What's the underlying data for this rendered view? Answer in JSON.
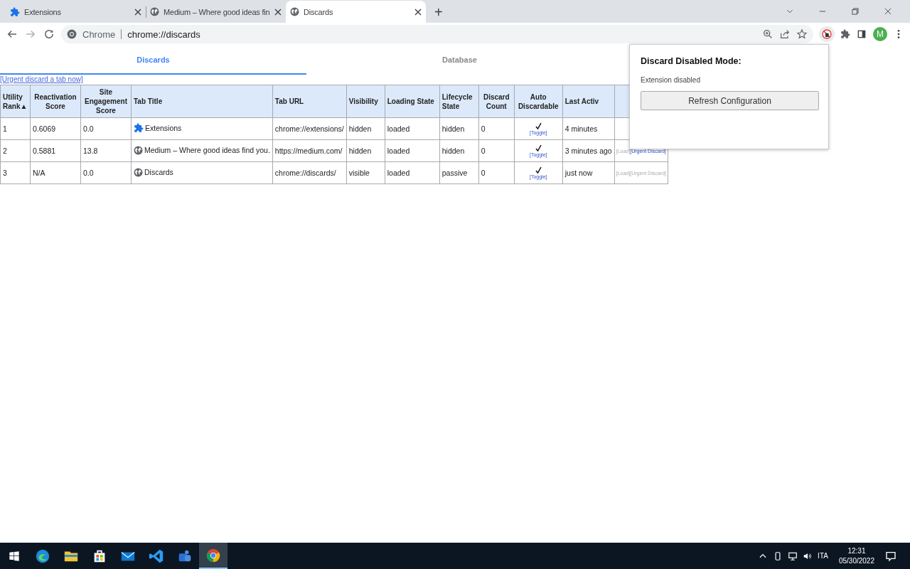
{
  "browser": {
    "tabs": [
      {
        "title": "Extensions",
        "kind": "puzzle",
        "selected": false
      },
      {
        "title": "Medium – Where good ideas fin",
        "kind": "globe",
        "selected": false
      },
      {
        "title": "Discards",
        "kind": "globe",
        "selected": true
      }
    ],
    "new_tab": "+",
    "omnibox": {
      "origin": "Chrome",
      "url": "chrome://discards"
    },
    "profile": "M"
  },
  "page": {
    "tabs": [
      {
        "label": "Discards",
        "selected": true
      },
      {
        "label": "Database",
        "selected": false
      }
    ],
    "urgent_link": "[Urgent discard a tab now]",
    "table": {
      "columns": [
        {
          "label": "Utility Rank",
          "sort": "▲"
        },
        {
          "label": "Reactivation Score"
        },
        {
          "label": "Site Engagement Score"
        },
        {
          "label": "Tab Title"
        },
        {
          "label": "Tab URL"
        },
        {
          "label": "Visibility"
        },
        {
          "label": "Loading State"
        },
        {
          "label": "Lifecycle State"
        },
        {
          "label": "Discard Count"
        },
        {
          "label": "Auto Discardable"
        },
        {
          "label": "Last Activ"
        }
      ],
      "rows": [
        {
          "rank": "1",
          "reactivation": "0.6069",
          "engagement": "0.0",
          "title": "Extensions",
          "kind": "puzzle",
          "url": "chrome://extensions/",
          "visibility": "hidden",
          "loading": "loaded",
          "lifecycle": "hidden",
          "discard_count": "0",
          "auto_discardable": true,
          "toggle": "[Toggle]",
          "last_active": "4 minutes"
        },
        {
          "rank": "2",
          "reactivation": "0.5881",
          "engagement": "13.8",
          "title": "Medium – Where good ideas find you.",
          "kind": "globe",
          "url": "https://medium.com/",
          "visibility": "hidden",
          "loading": "loaded",
          "lifecycle": "hidden",
          "discard_count": "0",
          "auto_discardable": true,
          "toggle": "[Toggle]",
          "last_active": "3 minutes ago",
          "actions": [
            {
              "label": "[Load]",
              "disabled": true
            },
            {
              "label": "[Urgent Discard]",
              "disabled": false
            }
          ]
        },
        {
          "rank": "3",
          "reactivation": "N/A",
          "engagement": "0.0",
          "title": "Discards",
          "kind": "globe",
          "url": "chrome://discards/",
          "visibility": "visible",
          "loading": "loaded",
          "lifecycle": "passive",
          "discard_count": "0",
          "auto_discardable": true,
          "toggle": "[Toggle]",
          "last_active": "just now",
          "actions": [
            {
              "label": "[Load]",
              "disabled": true
            },
            {
              "label": "[Urgent Discard]",
              "disabled": true
            }
          ]
        }
      ]
    }
  },
  "popup": {
    "title": "Discard Disabled Mode:",
    "status": "Extension disabled",
    "button": "Refresh Configuration"
  },
  "taskbar": {
    "apps": [
      {
        "kind": "edge",
        "selected": false
      },
      {
        "kind": "folder",
        "selected": false
      },
      {
        "kind": "store",
        "selected": false
      },
      {
        "kind": "mail",
        "selected": false
      },
      {
        "kind": "code",
        "selected": false
      },
      {
        "kind": "teams",
        "selected": false
      },
      {
        "kind": "chrome",
        "selected": true
      }
    ],
    "language": "ITA",
    "time": "12:31",
    "date": "05/30/2022"
  }
}
